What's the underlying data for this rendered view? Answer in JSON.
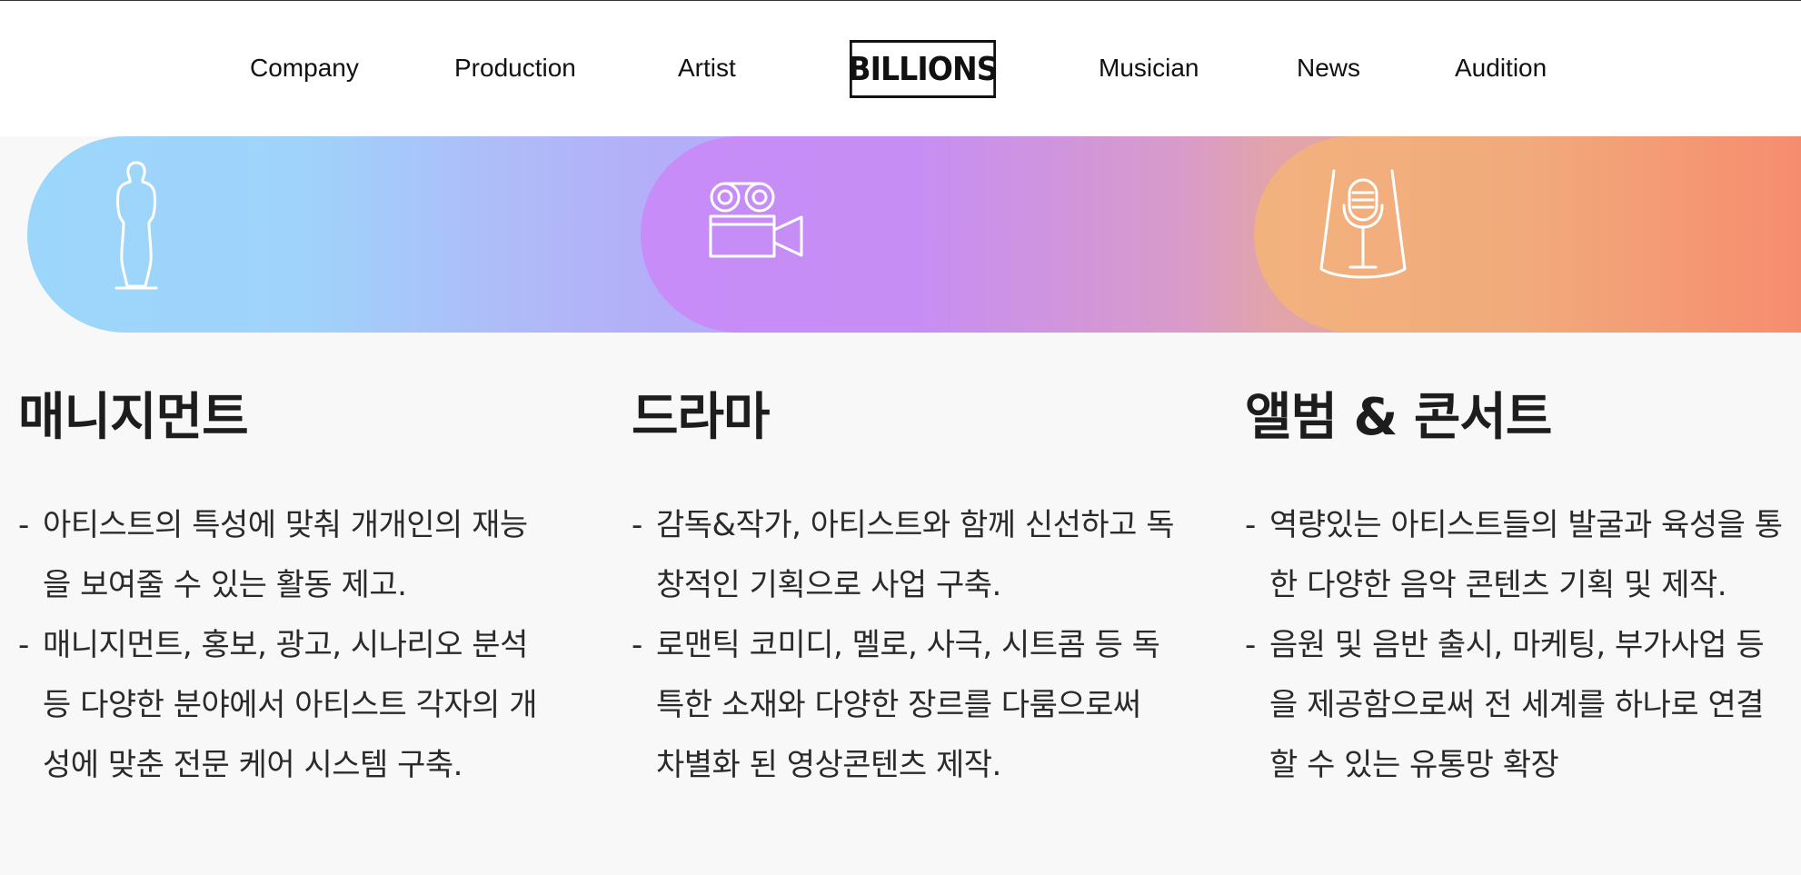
{
  "nav": {
    "left": [
      "Company",
      "Production",
      "Artist"
    ],
    "logo": "BILLIONS",
    "right": [
      "Musician",
      "News",
      "Audition"
    ]
  },
  "icons": [
    "actor-figure-icon",
    "film-camera-icon",
    "microphone-icon"
  ],
  "sections": [
    {
      "title": "매니지먼트",
      "items": [
        "아티스트의 특성에 맞춰 개개인의 재능을 보여줄 수 있는 활동 제고.",
        "매니지먼트, 홍보, 광고, 시나리오 분석 등 다양한 분야에서 아티스트 각자의 개성에 맞춘 전문 케어 시스템 구축."
      ]
    },
    {
      "title": "드라마",
      "items": [
        "감독&작가, 아티스트와 함께 신선하고 독창적인 기획으로 사업 구축.",
        "로맨틱 코미디, 멜로, 사극, 시트콤 등 독특한 소재와 다양한 장르를 다룸으로써 차별화 된 영상콘텐츠 제작."
      ]
    },
    {
      "title": "앨범 & 콘서트",
      "items": [
        "역량있는 아티스트들의 발굴과 육성을 통한 다양한 음악 콘텐츠 기획 및 제작.",
        "음원 및 음반 출시, 마케팅, 부가사업 등을 제공함으로써 전 세계를 하나로 연결할 수 있는 유통망 확장"
      ]
    }
  ],
  "colors": {
    "blue": "#9dd6fb",
    "purple": "#c78cf8",
    "orange": "#f2b27e",
    "coral": "#f68c6e"
  }
}
